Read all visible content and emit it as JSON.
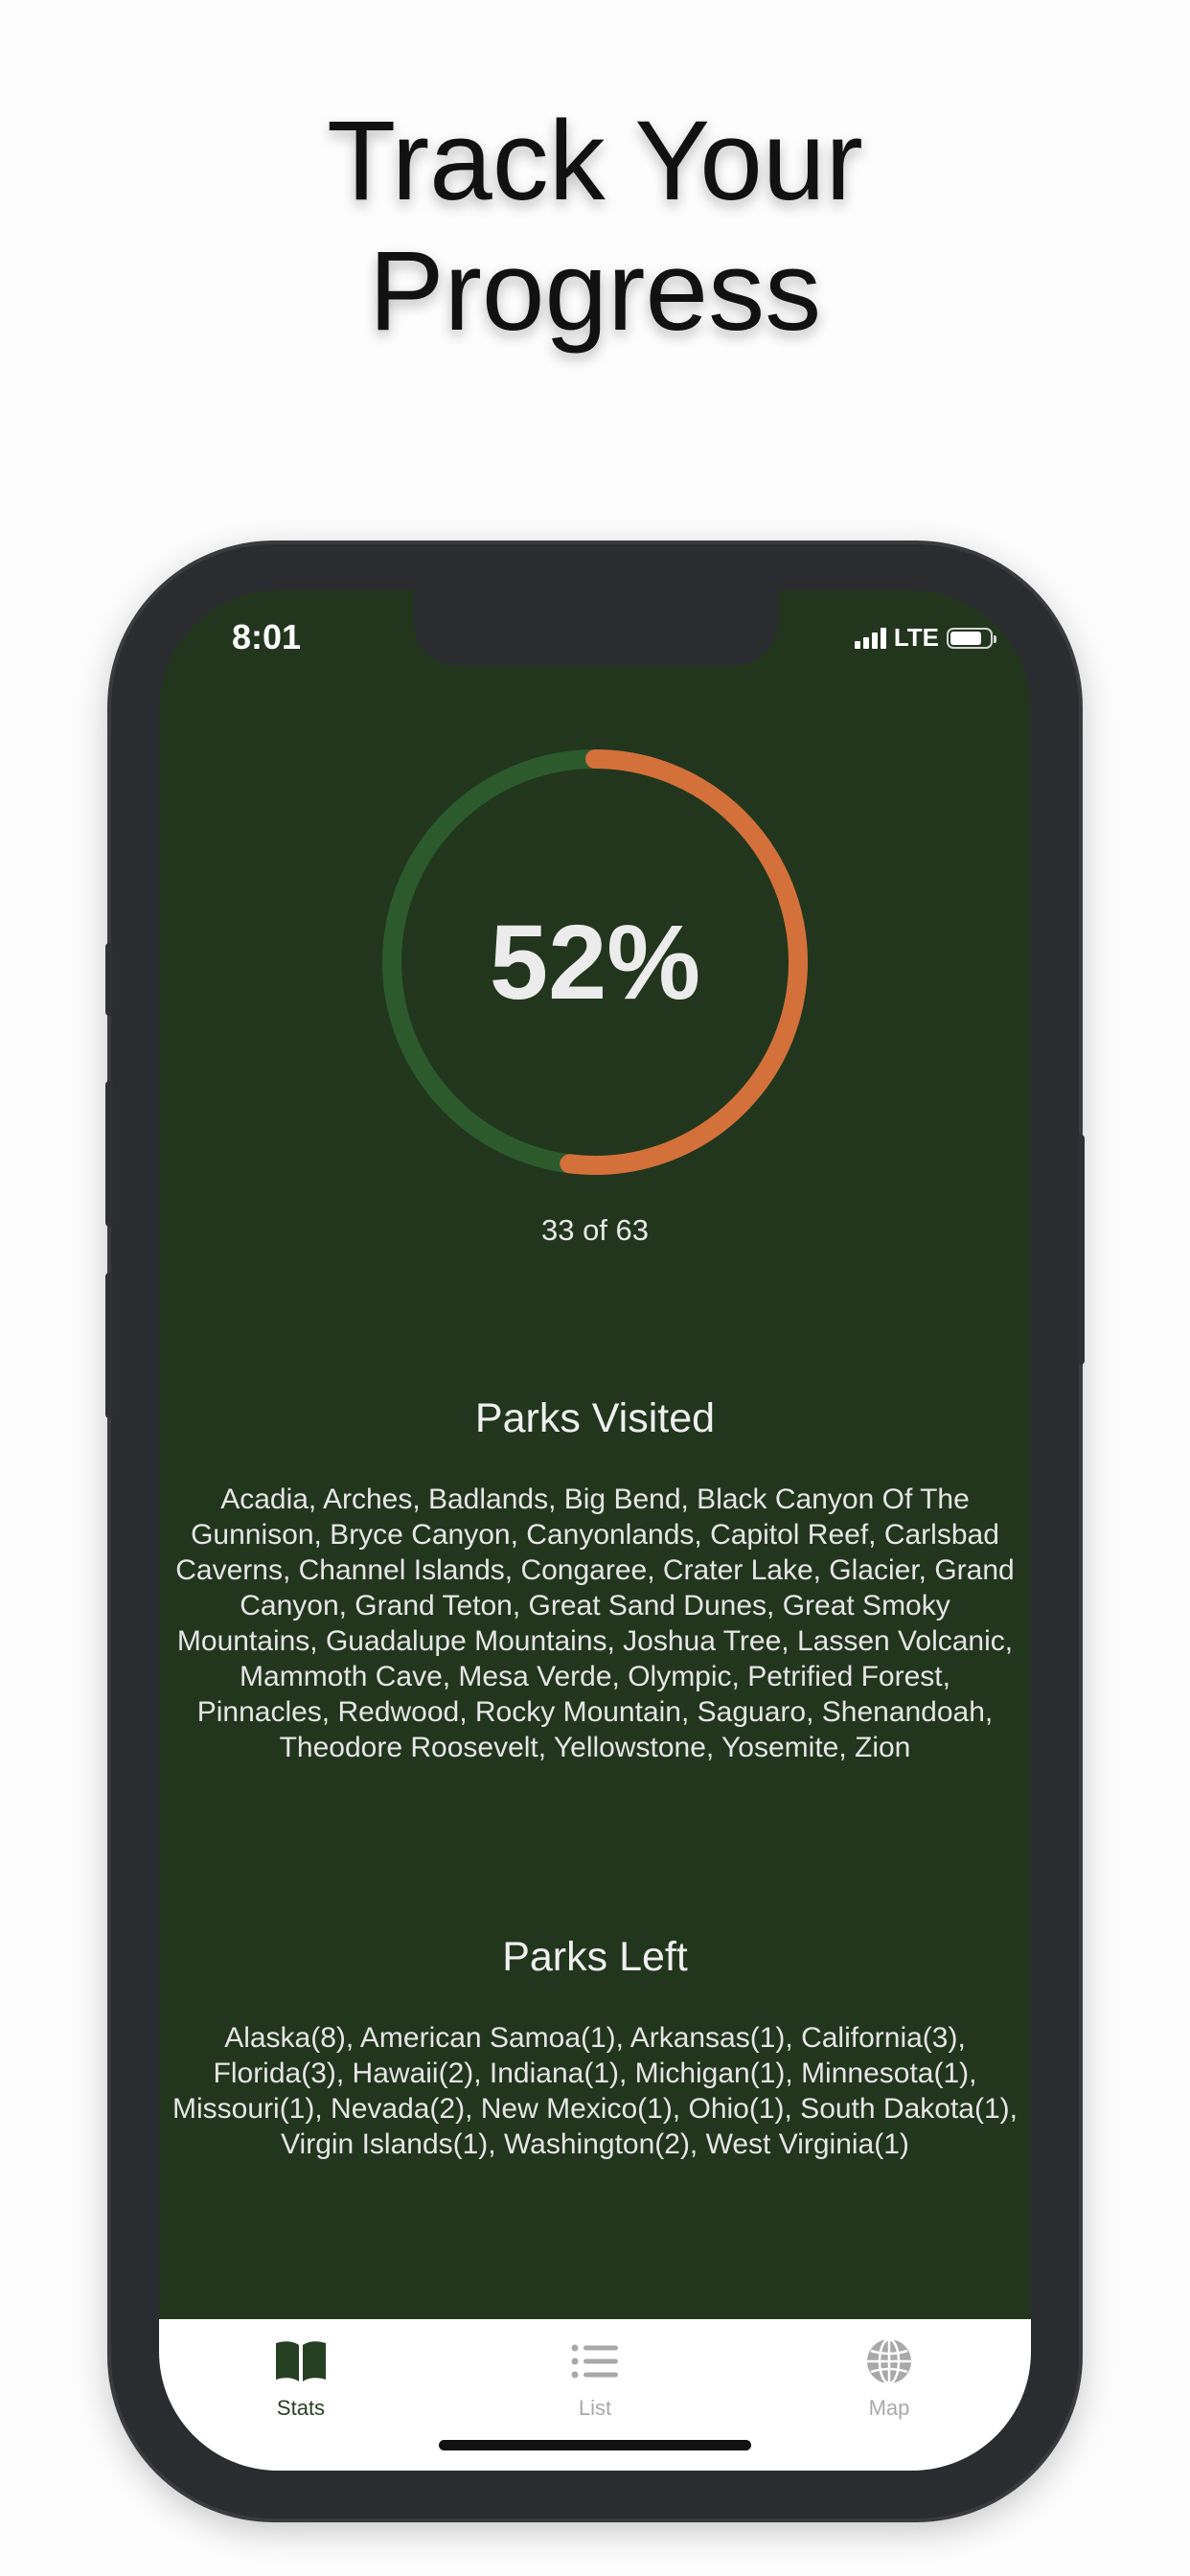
{
  "headline": {
    "line1": "Track Your",
    "line2": "Progress"
  },
  "status_bar": {
    "time": "8:01",
    "network": "LTE"
  },
  "progress": {
    "percent_label": "52%",
    "fraction": 0.52,
    "count_label": "33 of 63",
    "colors": {
      "progress": "#d4703a",
      "track": "#2c5a2c"
    }
  },
  "visited": {
    "title": "Parks Visited",
    "body": "Acadia, Arches, Badlands, Big Bend, Black Canyon Of The Gunnison, Bryce Canyon, Canyonlands, Capitol Reef, Carlsbad Caverns, Channel Islands, Congaree, Crater Lake, Glacier, Grand Canyon, Grand Teton, Great Sand Dunes, Great Smoky Mountains, Guadalupe Mountains, Joshua Tree, Lassen Volcanic, Mammoth Cave, Mesa Verde, Olympic, Petrified Forest, Pinnacles, Redwood, Rocky Mountain, Saguaro, Shenandoah, Theodore Roosevelt, Yellowstone, Yosemite, Zion"
  },
  "left": {
    "title": "Parks Left",
    "body": "Alaska(8), American Samoa(1), Arkansas(1), California(3), Florida(3), Hawaii(2), Indiana(1), Michigan(1), Minnesota(1), Missouri(1), Nevada(2), New Mexico(1), Ohio(1), South Dakota(1), Virgin Islands(1), Washington(2), West Virginia(1)"
  },
  "tabs": [
    {
      "label": "Stats",
      "icon": "book-icon",
      "active": true
    },
    {
      "label": "List",
      "icon": "list-icon",
      "active": false
    },
    {
      "label": "Map",
      "icon": "globe-icon",
      "active": false
    }
  ],
  "colors": {
    "screen_bg": "#22361d",
    "tab_active": "#264023",
    "tab_inactive": "#a9a9a9"
  }
}
